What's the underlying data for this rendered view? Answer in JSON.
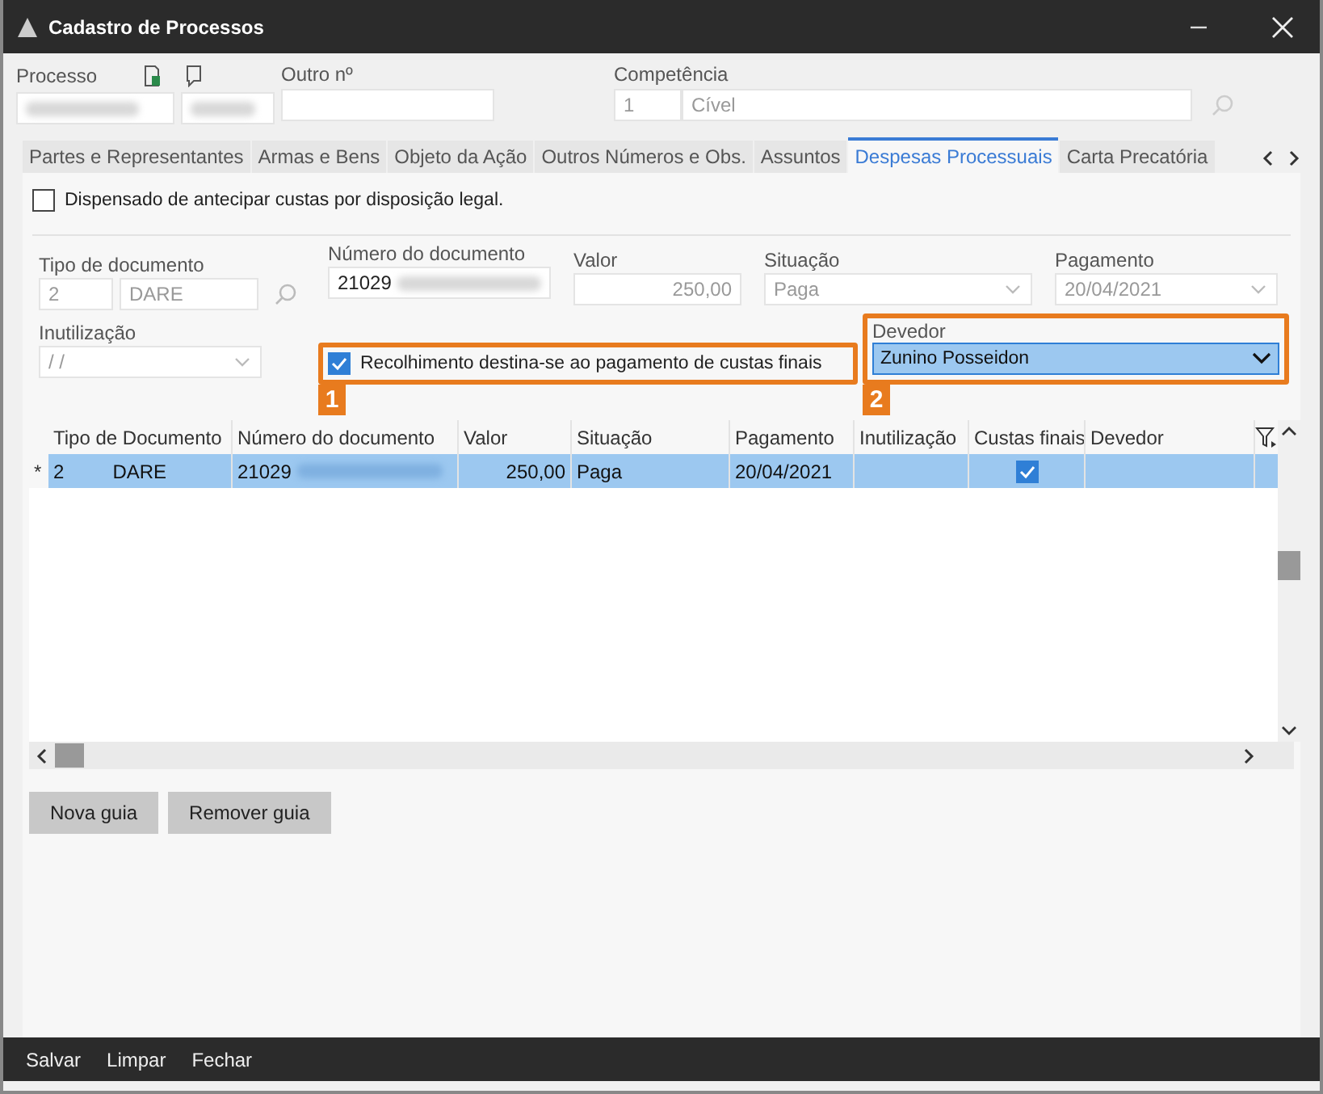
{
  "window": {
    "title": "Cadastro de Processos"
  },
  "header": {
    "processo_label": "Processo",
    "outro_label": "Outro nº",
    "competencia_label": "Competência",
    "competencia_code": "1",
    "competencia_value": "Cível"
  },
  "tabs": [
    {
      "label": "Partes e Representantes",
      "selected": false
    },
    {
      "label": "Armas e Bens",
      "selected": false
    },
    {
      "label": "Objeto da Ação",
      "selected": false
    },
    {
      "label": "Outros Números e Obs.",
      "selected": false
    },
    {
      "label": "Assuntos",
      "selected": false
    },
    {
      "label": "Despesas Processuais",
      "selected": true
    },
    {
      "label": "Carta Precatória",
      "selected": false
    }
  ],
  "dispensado": {
    "label": "Dispensado de antecipar custas por disposição legal.",
    "checked": false
  },
  "form": {
    "tipo_label": "Tipo de documento",
    "tipo_code": "2",
    "tipo_value": "DARE",
    "numero_label": "Número do documento",
    "numero_value": "21029",
    "valor_label": "Valor",
    "valor_value": "250,00",
    "situacao_label": "Situação",
    "situacao_value": "Paga",
    "pagamento_label": "Pagamento",
    "pagamento_value": "20/04/2021",
    "inutilizacao_label": "Inutilização",
    "inutilizacao_value": "/ /",
    "recolhimento": {
      "label": "Recolhimento destina-se ao pagamento de custas finais",
      "checked": true
    },
    "devedor_label": "Devedor",
    "devedor_value": "Zunino Posseidon"
  },
  "annotations": [
    {
      "number": "1"
    },
    {
      "number": "2"
    }
  ],
  "table": {
    "columns": [
      "Tipo de Documento",
      "Número do documento",
      "Valor",
      "Situação",
      "Pagamento",
      "Inutilização",
      "Custas finais",
      "Devedor"
    ],
    "rows": [
      {
        "marker": "*",
        "selected": true,
        "tipo_code": "2",
        "tipo": "DARE",
        "numero": "21029",
        "valor": "250,00",
        "situacao": "Paga",
        "pagamento": "20/04/2021",
        "inutilizacao": "",
        "custas_finais": true,
        "devedor": ""
      }
    ]
  },
  "buttons": [
    "Nova guia",
    "Remover guia"
  ],
  "footer": [
    "Salvar",
    "Limpar",
    "Fechar"
  ]
}
